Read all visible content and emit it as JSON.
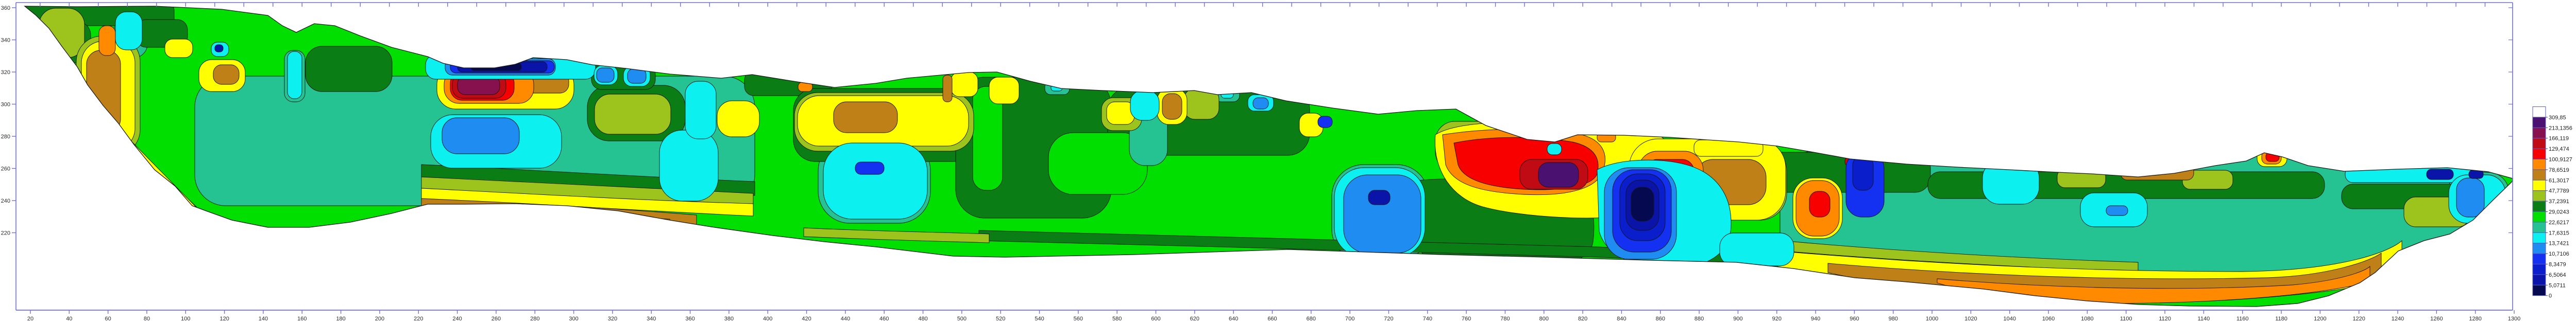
{
  "frame_color": "#7070cf",
  "text_color": "#2b2b2b",
  "chart_data": {
    "type": "heatmap",
    "subtype": "2D-resistivity-contour-cross-section",
    "grid": false,
    "x_axis": {
      "min": 10,
      "max": 1315,
      "tick_interval": 20,
      "ticks": [
        20,
        40,
        60,
        80,
        100,
        120,
        140,
        160,
        180,
        200,
        220,
        240,
        260,
        280,
        300,
        320,
        340,
        360,
        380,
        400,
        420,
        440,
        460,
        480,
        500,
        520,
        540,
        560,
        580,
        600,
        620,
        640,
        660,
        680,
        700,
        720,
        740,
        760,
        780,
        800,
        820,
        840,
        860,
        880,
        900,
        920,
        940,
        960,
        980,
        1000,
        1020,
        1040,
        1060,
        1080,
        1100,
        1120,
        1140,
        1160,
        1180,
        1200,
        1220,
        1240,
        1260,
        1280,
        1300
      ]
    },
    "y_axis": {
      "min": 172,
      "max": 368,
      "tick_interval": 20,
      "ticks": [
        360,
        340,
        320,
        300,
        280,
        260,
        240,
        220
      ]
    },
    "top_axis": {
      "tick_first": 25,
      "tick_interval": 15,
      "tick_last": 1285
    },
    "legend": {
      "position": "right",
      "above_max_color": "#ffffff",
      "levels": [
        "309,85",
        "213,1356",
        "166,119",
        "129,474",
        "100,9127",
        "78,6519",
        "61,3017",
        "47,7789",
        "37,2391",
        "29,0243",
        "22,6217",
        "17,6315",
        "13,7421",
        "10,7106",
        "8,3479",
        "6,5064",
        "5,0711",
        "0"
      ],
      "colors": [
        "#ffffff",
        "#4b1170",
        "#86114e",
        "#c00a14",
        "#f80000",
        "#ff8a00",
        "#c08018",
        "#ffff00",
        "#9cc41c",
        "#0a7e14",
        "#00df00",
        "#26c392",
        "#0cf0f0",
        "#1e8cf0",
        "#1430f0",
        "#0a1ecc",
        "#0a14a8",
        "#050a50"
      ]
    },
    "features": [
      {
        "name": "resistive-plume-left",
        "distance": [
          49,
          67
        ],
        "elevation": [
          283,
          348
        ],
        "class": "high 61-101"
      },
      {
        "name": "shallow-conductive-band",
        "distance": [
          241,
          286
        ],
        "elevation": [
          319,
          326
        ],
        "class": "very low <8"
      },
      {
        "name": "hot-spot-A",
        "distance": [
          237,
          278
        ],
        "elevation": [
          301,
          321
        ],
        "class": "very high 129-213"
      },
      {
        "name": "conductive-lens-A",
        "distance": [
          227,
          293
        ],
        "elevation": [
          260,
          293
        ],
        "class": "low 8-14"
      },
      {
        "name": "brown-core-band",
        "distance": [
          434,
          467
        ],
        "elevation": [
          282,
          301
        ],
        "class": "high 61-79"
      },
      {
        "name": "conductive-lens-B",
        "distance": [
          429,
          482
        ],
        "elevation": [
          228,
          275
        ],
        "class": "low 8-18"
      },
      {
        "name": "cold-blob-B",
        "distance": [
          693,
          738
        ],
        "elevation": [
          205,
          260
        ],
        "class": "low 5-14"
      },
      {
        "name": "hot-body-largest",
        "distance": [
          744,
          830
        ],
        "elevation": [
          231,
          288
        ],
        "class": "very high >213 purple core"
      },
      {
        "name": "hot-spot-C",
        "distance": [
          849,
          881
        ],
        "elevation": [
          242,
          270
        ],
        "class": "very high >213 purple core"
      },
      {
        "name": "deep-cold-blob",
        "distance": [
          829,
          896
        ],
        "elevation": [
          197,
          266
        ],
        "class": "very low <5 core"
      },
      {
        "name": "blue-vertical-blob",
        "distance": [
          956,
          975
        ],
        "elevation": [
          230,
          269
        ],
        "class": "low 5-11"
      },
      {
        "name": "orange-blob-D",
        "distance": [
          930,
          952
        ],
        "elevation": [
          218,
          252
        ],
        "class": "high 79-129"
      },
      {
        "name": "deep-resistive-sheet-right",
        "distance": [
          981,
          1226
        ],
        "elevation": [
          173,
          219
        ],
        "class": "high 61-101"
      },
      {
        "name": "bottom-resistive-strata-left",
        "distance": [
          222,
          392
        ],
        "elevation": [
          237,
          254
        ],
        "class": "high 48-101"
      },
      {
        "name": "surface-conductive-band-right",
        "distance": [
          1213,
          1280
        ],
        "elevation": [
          251,
          261
        ],
        "class": "low 5-14"
      }
    ]
  }
}
